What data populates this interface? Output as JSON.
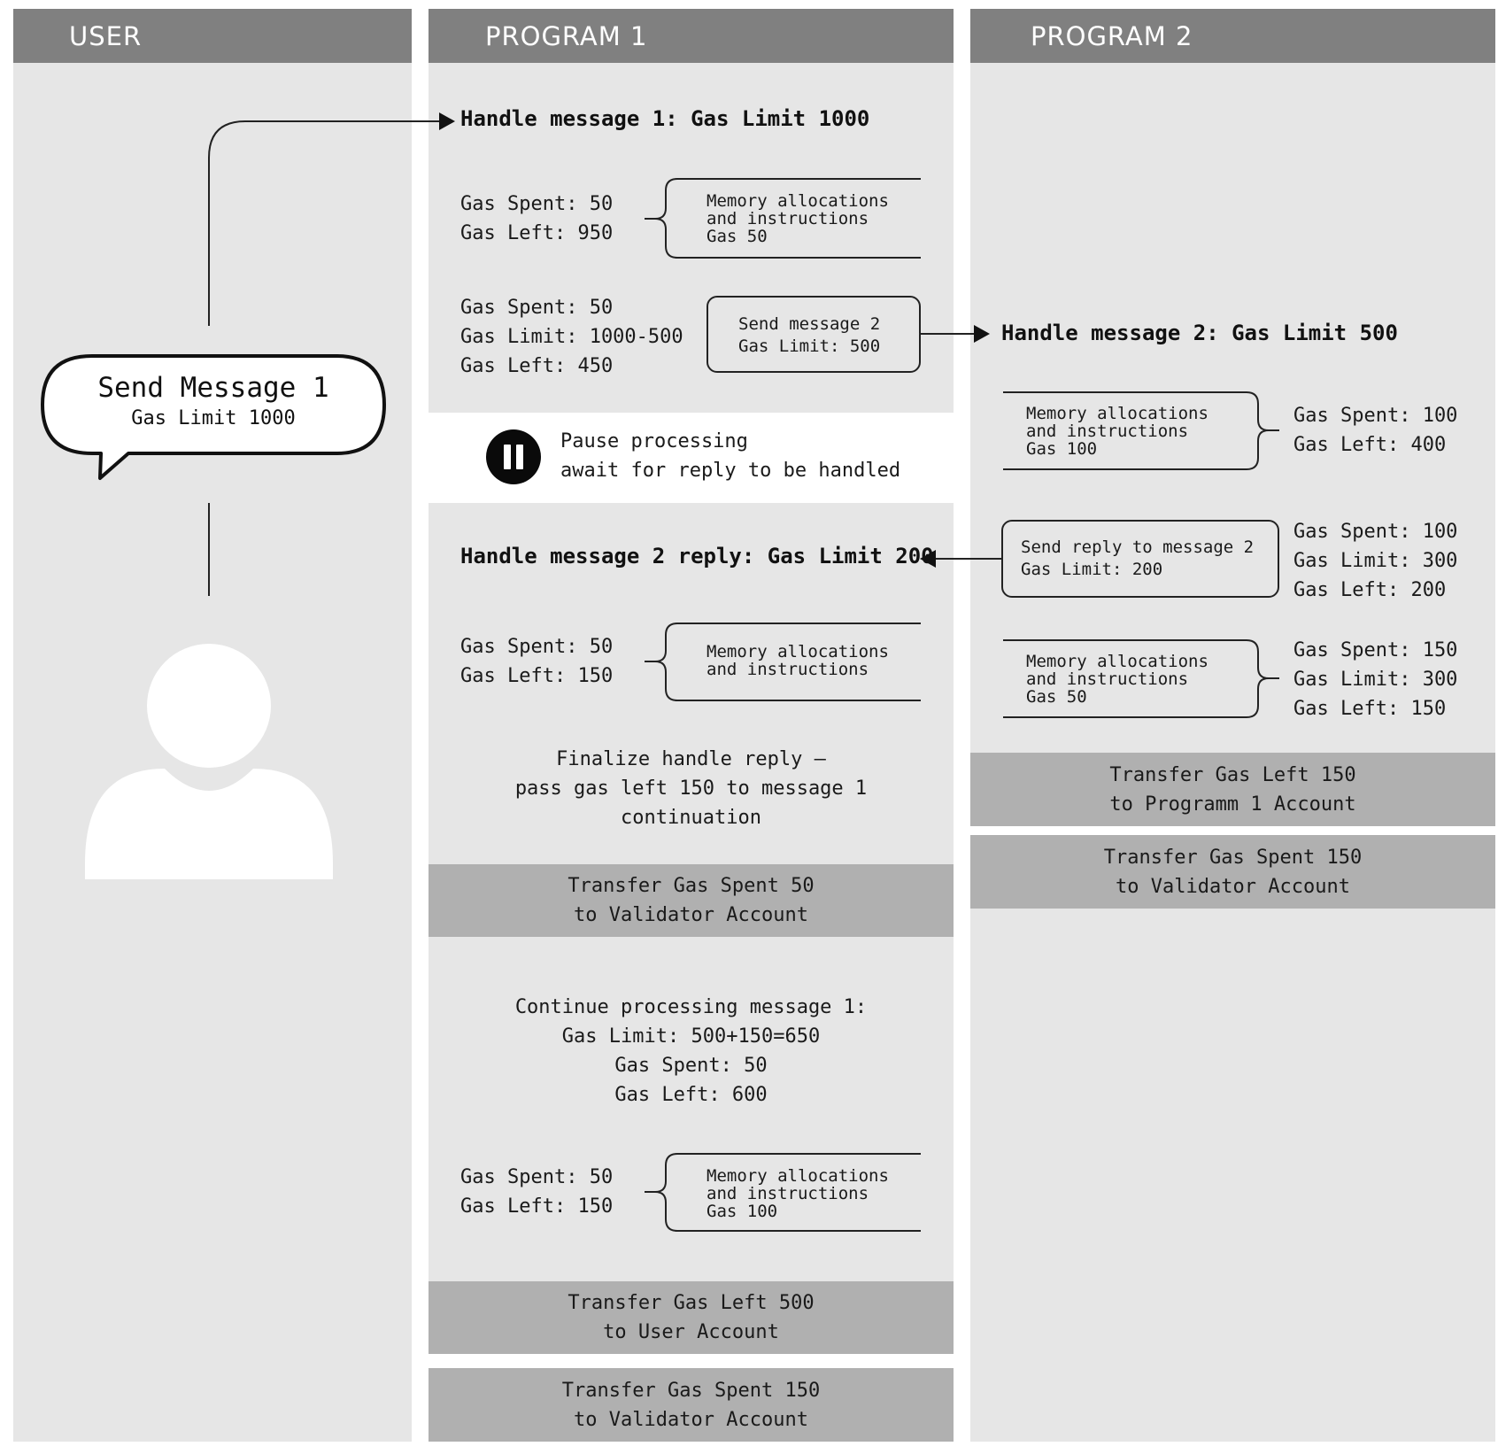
{
  "lanes": {
    "user": "USER",
    "program1": "PROGRAM 1",
    "program2": "PROGRAM 2"
  },
  "user": {
    "bubble_title": "Send Message 1",
    "bubble_sub": "Gas Limit 1000"
  },
  "program1": {
    "handle1_title": "Handle message 1: Gas Limit 1000",
    "step1_spent": "Gas Spent: 50",
    "step1_left": "Gas Left: 950",
    "mem1_line1": "Memory allocations",
    "mem1_line2": "and instructions",
    "mem1_line3": "Gas 50",
    "step2_spent": "Gas Spent: 50",
    "step2_limit": "Gas Limit: 1000-500",
    "step2_left": "Gas Left: 450",
    "send2_line1": "Send message 2",
    "send2_line2": "Gas Limit: 500",
    "pause_line1": "Pause processing",
    "pause_line2": "await for reply to be handled",
    "reply_title": "Handle message 2 reply: Gas Limit 200",
    "step3_spent": "Gas Spent: 50",
    "step3_left": "Gas Left: 150",
    "mem3_line1": "Memory allocations",
    "mem3_line2": "and instructions",
    "finalize_line1": "Finalize handle reply –",
    "finalize_line2": "pass gas left 150 to message 1",
    "finalize_line3": "continuation",
    "transfer1_line1": "Transfer Gas Spent 50",
    "transfer1_line2": "to Validator Account",
    "continue_line1": "Continue processing message 1:",
    "continue_line2": "Gas Limit: 500+150=650",
    "continue_line3": "Gas Spent: 50",
    "continue_line4": "Gas Left: 600",
    "step4_spent": "Gas Spent: 50",
    "step4_left": "Gas Left: 150",
    "mem4_line1": "Memory allocations",
    "mem4_line2": "and instructions",
    "mem4_line3": "Gas 100",
    "transfer2_line1": "Transfer Gas Left 500",
    "transfer2_line2": "to User Account",
    "transfer3_line1": "Transfer Gas Spent 150",
    "transfer3_line2": "to Validator Account"
  },
  "program2": {
    "handle2_title": "Handle message 2: Gas Limit 500",
    "mem1_line1": "Memory allocations",
    "mem1_line2": "and instructions",
    "mem1_line3": "Gas 100",
    "stat1_spent": "Gas Spent: 100",
    "stat1_left": "Gas Left: 400",
    "reply_line1": "Send reply to message 2",
    "reply_line2": "Gas Limit: 200",
    "stat2_spent": "Gas Spent: 100",
    "stat2_limit": "Gas Limit: 300",
    "stat2_left": "Gas Left: 200",
    "mem2_line1": "Memory allocations",
    "mem2_line2": "and instructions",
    "mem2_line3": "Gas 50",
    "stat3_spent": "Gas Spent: 150",
    "stat3_limit": "Gas Limit: 300",
    "stat3_left": "Gas Left: 150",
    "transfer1_line1": "Transfer Gas Left 150",
    "transfer1_line2": "to Programm 1 Account",
    "transfer2_line1": "Transfer Gas Spent 150",
    "transfer2_line2": "to Validator Account"
  },
  "colors": {
    "lane_bg": "#e6e6e6",
    "header_bg": "#808080",
    "transfer_bg": "#b0b0b0",
    "line": "#222222"
  }
}
